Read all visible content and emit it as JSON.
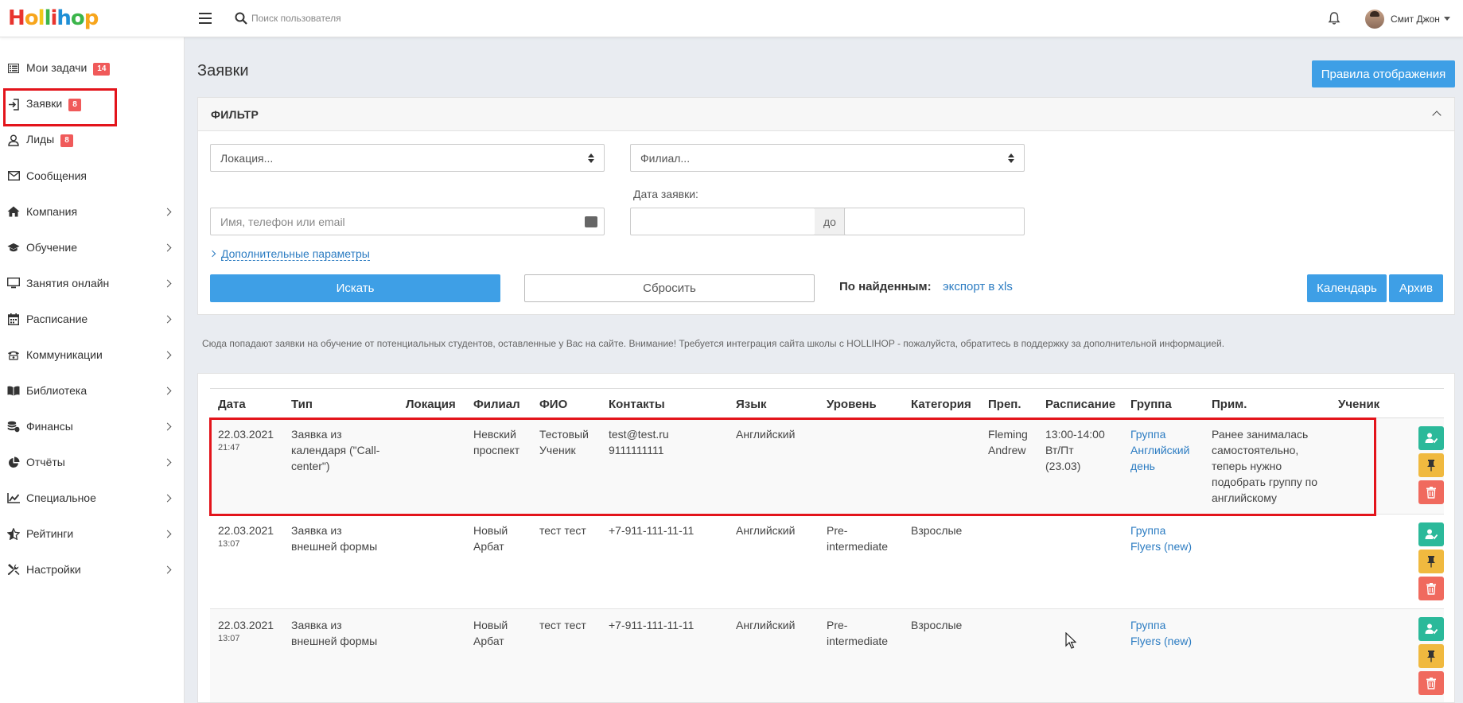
{
  "app": {
    "logo_text": "Hollihop"
  },
  "header": {
    "search_placeholder": "Поиск пользователя",
    "user_name": "Смит Джон"
  },
  "sidebar": {
    "items": [
      {
        "label": "Мои задачи",
        "badge": "14",
        "icon": "tasks-icon"
      },
      {
        "label": "Заявки",
        "badge": "8",
        "icon": "sign-in-icon"
      },
      {
        "label": "Лиды",
        "badge": "8",
        "icon": "user-icon"
      },
      {
        "label": "Сообщения",
        "icon": "envelope-icon"
      },
      {
        "label": "Компания",
        "icon": "home-icon"
      },
      {
        "label": "Обучение",
        "icon": "graduation-cap-icon"
      },
      {
        "label": "Занятия онлайн",
        "icon": "monitor-icon"
      },
      {
        "label": "Расписание",
        "icon": "calendar-icon"
      },
      {
        "label": "Коммуникации",
        "icon": "phone-icon"
      },
      {
        "label": "Библиотека",
        "icon": "book-icon"
      },
      {
        "label": "Финансы",
        "icon": "coins-icon"
      },
      {
        "label": "Отчёты",
        "icon": "pie-chart-icon"
      },
      {
        "label": "Специальное",
        "icon": "line-chart-icon"
      },
      {
        "label": "Рейтинги",
        "icon": "star-icon"
      },
      {
        "label": "Настройки",
        "icon": "wrench-icon"
      }
    ]
  },
  "page": {
    "title": "Заявки",
    "rules_button": "Правила отображения"
  },
  "filter": {
    "title": "ФИЛЬТР",
    "location_select": "Локация...",
    "branch_select": "Филиал...",
    "date_label": "Дата заявки:",
    "name_placeholder": "Имя, телефон или email",
    "date_to": "до",
    "more_params": "Дополнительные параметры",
    "search_button": "Искать",
    "reset_button": "Сбросить",
    "found_label": "По найденным:",
    "export_link": "экспорт в xls",
    "calendar_button": "Календарь",
    "archive_button": "Архив"
  },
  "info_text": "Сюда попадают заявки на обучение от потенциальных студентов, оставленные у Вас на сайте. Внимание! Требуется интеграция сайта школы с HOLLIHOP - пожалуйста, обратитесь в поддержку за дополнительной информацией.",
  "table": {
    "headers": [
      "Дата",
      "Тип",
      "Локация",
      "Филиал",
      "ФИО",
      "Контакты",
      "Язык",
      "Уровень",
      "Категория",
      "Преп.",
      "Расписание",
      "Группа",
      "Прим.",
      "Ученик"
    ],
    "rows": [
      {
        "date": "22.03.2021",
        "time": "21:47",
        "type": "Заявка из календаря (\"Call-center\")",
        "location": "",
        "branch": "Невский проспект",
        "name": "Тестовый Ученик",
        "contacts": [
          "test@test.ru",
          "9111111111"
        ],
        "language": "Английский",
        "level": "",
        "category": "",
        "teacher": "Fleming Andrew",
        "schedule": [
          "13:00-14:00",
          "Вт/Пт",
          "(23.03)"
        ],
        "group": "Группа Английский день",
        "note": "Ранее занималась самостоятельно, теперь нужно подобрать группу по английскому",
        "student": ""
      },
      {
        "date": "22.03.2021",
        "time": "13:07",
        "type": "Заявка из внешней формы",
        "location": "",
        "branch": "Новый Арбат",
        "name": "тест тест",
        "contacts": [
          "+7-911-111-11-11"
        ],
        "language": "Английский",
        "level": "Pre-intermediate",
        "category": "Взрослые",
        "teacher": "",
        "schedule": [],
        "group": "Группа Flyers (new)",
        "note": "",
        "student": ""
      },
      {
        "date": "22.03.2021",
        "time": "13:07",
        "type": "Заявка из внешней формы",
        "location": "",
        "branch": "Новый Арбат",
        "name": "тест тест",
        "contacts": [
          "+7-911-111-11-11"
        ],
        "language": "Английский",
        "level": "Pre-intermediate",
        "category": "Взрослые",
        "teacher": "",
        "schedule": [],
        "group": "Группа Flyers (new)",
        "note": "",
        "student": ""
      }
    ]
  },
  "colors": {
    "accent": "#3e9fe6",
    "badge": "#f05a5a",
    "highlight": "#e3141b",
    "action_green": "#2bb99a",
    "action_yellow": "#f0b93f",
    "action_red": "#f06a5e"
  }
}
